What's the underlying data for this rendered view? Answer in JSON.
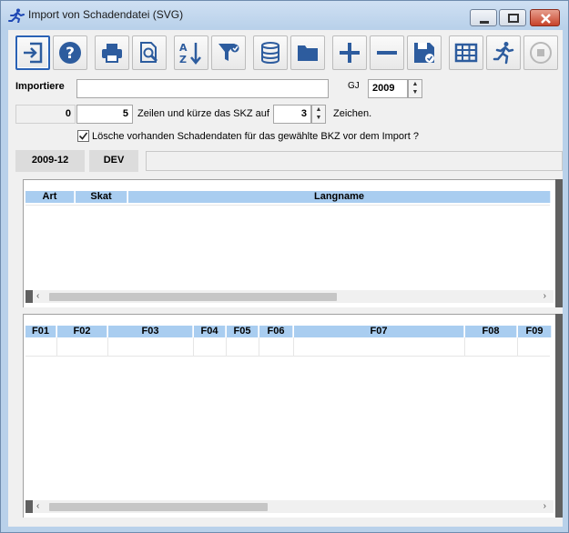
{
  "window": {
    "title": "Import von Schadendatei (SVG)"
  },
  "toolbar": {
    "buttons": [
      {
        "name": "exit"
      },
      {
        "name": "help"
      },
      {
        "name": "print"
      },
      {
        "name": "preview"
      },
      {
        "name": "sort"
      },
      {
        "name": "filter"
      },
      {
        "name": "database"
      },
      {
        "name": "folder"
      },
      {
        "name": "add"
      },
      {
        "name": "remove"
      },
      {
        "name": "save"
      },
      {
        "name": "table"
      },
      {
        "name": "run"
      },
      {
        "name": "stop"
      }
    ]
  },
  "form": {
    "importiere_label": "Importiere",
    "importiere_value": "",
    "gj_label": "GJ",
    "gj_value": "2009",
    "count_value": "0",
    "rows_value": "5",
    "rows_label": "Zeilen und kürze das SKZ auf",
    "chars_value": "3",
    "chars_label": "Zeichen.",
    "delete_label": "Lösche vorhanden Schadendaten für das gewählte BKZ vor dem Import ?",
    "delete_checked": true
  },
  "tabs": [
    {
      "label": "2009-12"
    },
    {
      "label": "DEV"
    }
  ],
  "grid1": {
    "columns": [
      "Art",
      "Skat",
      "Langname"
    ]
  },
  "grid2": {
    "columns": [
      "F01",
      "F02",
      "F03",
      "F04",
      "F05",
      "F06",
      "F07",
      "F08",
      "F09"
    ]
  },
  "colors": {
    "header": "#a9cdf0",
    "frame": "#b9d1ea",
    "icon": "#2d5c9e"
  }
}
